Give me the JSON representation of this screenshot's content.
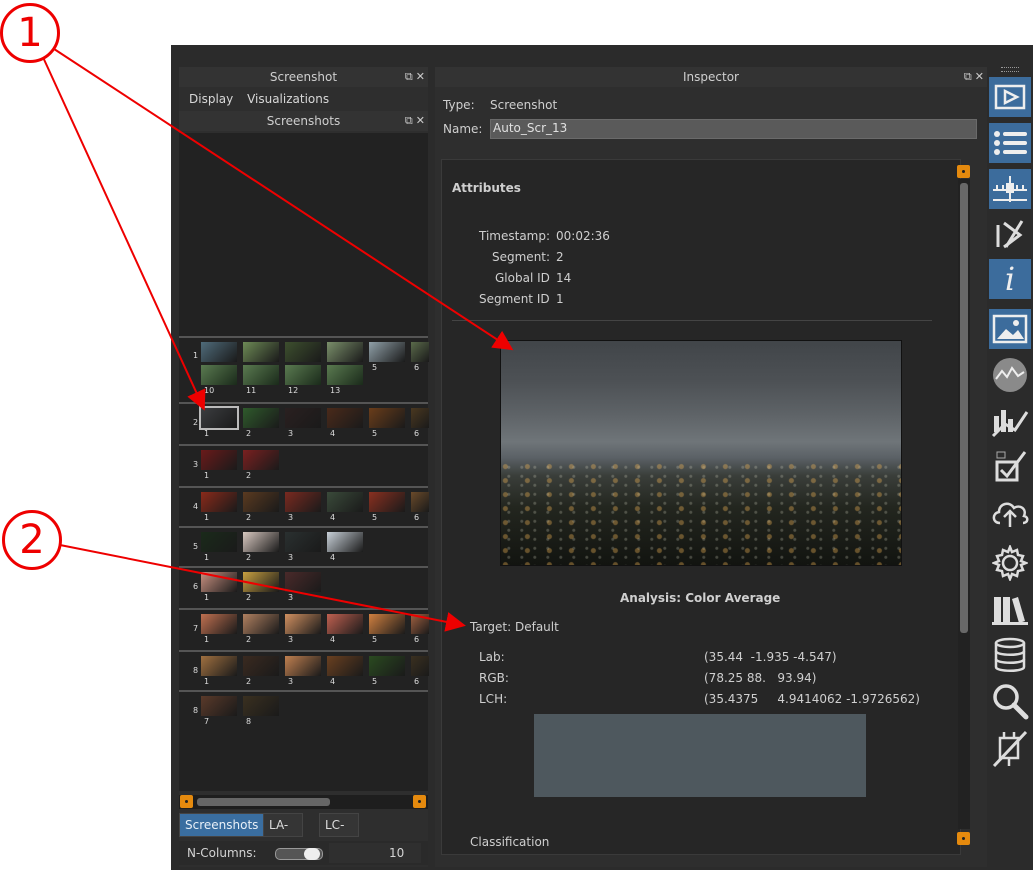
{
  "screenshot_dock": {
    "title": "Screenshot",
    "menu": [
      "Display",
      "Visualizations"
    ],
    "sub_title": "Screenshots",
    "rows": [
      {
        "segment": "1",
        "indices": [
          "",
          "",
          "",
          "",
          "5",
          "6"
        ],
        "second_indices": [
          "10",
          "11",
          "12",
          "13"
        ]
      },
      {
        "segment": "2",
        "indices": [
          "1",
          "2",
          "3",
          "4",
          "5",
          "6"
        ]
      },
      {
        "segment": "3",
        "indices": [
          "1",
          "2"
        ]
      },
      {
        "segment": "4",
        "indices": [
          "1",
          "2",
          "3",
          "4",
          "5",
          "6"
        ]
      },
      {
        "segment": "5",
        "indices": [
          "1",
          "2",
          "3",
          "4"
        ]
      },
      {
        "segment": "6",
        "indices": [
          "1",
          "2",
          "3"
        ]
      },
      {
        "segment": "7",
        "indices": [
          "1",
          "2",
          "3",
          "4",
          "5",
          "6"
        ]
      },
      {
        "segment": "8",
        "indices": [
          "1",
          "2",
          "3",
          "4",
          "5",
          "6"
        ]
      },
      {
        "segment": "8",
        "indices": [
          "7",
          "8"
        ]
      }
    ],
    "tabs": [
      "Screenshots",
      "LA-View",
      "LC-View"
    ],
    "ncolumns_label": "N-Columns:",
    "ncolumns_value": "10"
  },
  "inspector": {
    "title": "Inspector",
    "type_label": "Type:",
    "type_value": "Screenshot",
    "name_label": "Name:",
    "name_value": "Auto_Scr_13",
    "attributes_heading": "Attributes",
    "timestamp_label": "Timestamp:",
    "timestamp_value": "00:02:36",
    "segment_label": "Segment:",
    "segment_value": "2",
    "global_id_label": "Global ID",
    "global_id_value": "14",
    "segment_id_label": "Segment ID",
    "segment_id_value": "1",
    "analysis_heading": "Analysis: Color Average",
    "target_label": "Target: Default",
    "lab_label": "Lab:",
    "lab_value": "(35.44  -1.935 -4.547)",
    "rgb_label": "RGB:",
    "rgb_value": "(78.25 88.   93.94)",
    "lch_label": "LCH:",
    "lch_value": "(35.4375     4.9414062 -1.9726562)",
    "swatch_color": "#4e585e",
    "classification_label": "Classification"
  },
  "sidebar_icons": [
    "player-icon",
    "list-icon",
    "timeline-icon",
    "filter-icon",
    "info-icon",
    "image-icon",
    "colorimetry-icon",
    "chart-icon",
    "checklist-icon",
    "cloud-upload-icon",
    "settings-icon",
    "library-icon",
    "database-icon",
    "search-icon",
    "plugin-disabled-icon"
  ],
  "annotations": {
    "one": "1",
    "two": "2",
    "color": "#e00000"
  }
}
